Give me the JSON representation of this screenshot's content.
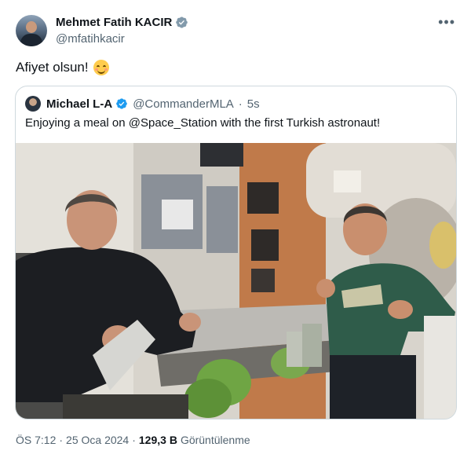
{
  "author": {
    "display_name": "Mehmet Fatih KACIR",
    "handle": "@mfatihkacir",
    "verified": true
  },
  "tweet": {
    "text": "Afiyet olsun!",
    "emoji": "smiling-face-icon"
  },
  "more_icon": "ellipsis-icon",
  "quoted": {
    "display_name": "Michael L-A",
    "handle": "@CommanderMLA",
    "separator": "·",
    "time": "5s",
    "text": "Enjoying a meal on @Space_Station with the first Turkish astronaut!",
    "image": "photo of two astronauts eating inside the space station module"
  },
  "footer": {
    "time": "ÖS 7:12",
    "separator": "·",
    "date": "25 Oca 2024",
    "separator2": "·",
    "views_count": "129,3 B",
    "views_label": "Görüntülenme"
  },
  "colors": {
    "verified_blue": "#1d9bf0",
    "text": "#0f1419",
    "secondary": "#536471",
    "border": "#cfd9de"
  }
}
